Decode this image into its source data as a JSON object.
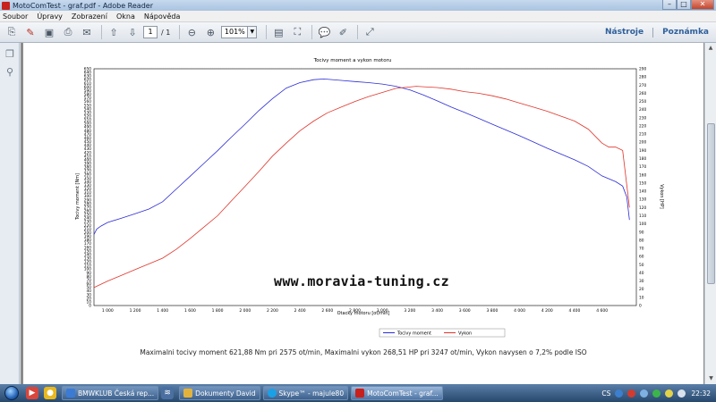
{
  "window": {
    "title": "MotoComTest - graf.pdf - Adobe Reader",
    "buttons": {
      "minimize": "–",
      "maximize": "□",
      "close": "✕"
    }
  },
  "menu": [
    "Soubor",
    "Úpravy",
    "Zobrazení",
    "Okna",
    "Nápověda"
  ],
  "toolbar": {
    "page_current": "1",
    "page_total": "/ 1",
    "zoom": "101%",
    "tools_link": "Nástroje",
    "comment_link": "Poznámka"
  },
  "document": {
    "watermark": "www.moravia-tuning.cz",
    "caption": "Maximalni tocivy moment 621,88 Nm pri 2575 ot/min,  Maximalni vykon 268,51 HP pri 3247 ot/min,  Vykon navysen o 7,2% podle ISO"
  },
  "chart_data": {
    "type": "line",
    "title": "Tocivy moment a vykon motoru",
    "xlabel": "Otacky motoru [ot/min]",
    "ylabel": "Tocivy moment [Nm]",
    "y2label": "Vykon [HP]",
    "xlim": [
      900,
      4850
    ],
    "ylim": [
      0,
      650
    ],
    "y2lim": [
      0,
      290
    ],
    "x_ticks": [
      1000,
      1200,
      1400,
      1600,
      1800,
      2000,
      2200,
      2400,
      2600,
      2800,
      3000,
      3200,
      3400,
      3600,
      3800,
      4000,
      4200,
      4400,
      4600
    ],
    "x_tick_labels": [
      "1 000",
      "1 200",
      "1 400",
      "1 600",
      "1 800",
      "2 000",
      "2 200",
      "2 400",
      "2 600",
      "2 800",
      "3 000",
      "3 200",
      "3 400",
      "3 600",
      "3 800",
      "4 000",
      "4 200",
      "4 400",
      "4 600"
    ],
    "y_ticks": [
      0,
      10,
      20,
      30,
      40,
      50,
      60,
      70,
      80,
      90,
      100,
      110,
      120,
      130,
      140,
      150,
      160,
      170,
      180,
      190,
      200,
      210,
      220,
      230,
      240,
      250,
      260,
      270,
      280,
      290,
      300,
      310,
      320,
      330,
      340,
      350,
      360,
      370,
      380,
      390,
      400,
      410,
      420,
      430,
      440,
      450,
      460,
      470,
      480,
      490,
      500,
      510,
      520,
      530,
      540,
      550,
      560,
      570,
      580,
      590,
      600,
      610,
      620,
      630,
      640,
      650
    ],
    "y2_ticks": [
      0,
      10,
      20,
      30,
      40,
      50,
      60,
      70,
      80,
      90,
      100,
      110,
      120,
      130,
      140,
      150,
      160,
      170,
      180,
      190,
      200,
      210,
      220,
      230,
      240,
      250,
      260,
      270,
      280,
      290
    ],
    "grid": true,
    "legend_position": "bottom-right",
    "series": [
      {
        "name": "Tocivy moment",
        "color": "#2b2bd6",
        "axis": "left",
        "x": [
          900,
          920,
          950,
          1000,
          1100,
          1200,
          1300,
          1400,
          1500,
          1600,
          1700,
          1800,
          1900,
          2000,
          2100,
          2200,
          2300,
          2400,
          2500,
          2575,
          2700,
          2800,
          2900,
          3000,
          3100,
          3200,
          3300,
          3400,
          3500,
          3600,
          3700,
          3800,
          3900,
          4000,
          4100,
          4200,
          4300,
          4400,
          4500,
          4600,
          4700,
          4750,
          4780,
          4800
        ],
        "y": [
          195,
          210,
          218,
          228,
          240,
          252,
          265,
          285,
          320,
          355,
          390,
          425,
          462,
          498,
          535,
          568,
          597,
          612,
          620,
          622,
          618,
          615,
          612,
          608,
          602,
          592,
          578,
          562,
          545,
          530,
          514,
          498,
          482,
          466,
          449,
          432,
          416,
          400,
          382,
          356,
          340,
          328,
          298,
          235
        ]
      },
      {
        "name": "Vykon",
        "color": "#e0342a",
        "axis": "right",
        "x": [
          900,
          1000,
          1100,
          1200,
          1300,
          1400,
          1500,
          1600,
          1700,
          1800,
          1900,
          2000,
          2100,
          2200,
          2300,
          2400,
          2500,
          2600,
          2700,
          2800,
          2900,
          3000,
          3100,
          3247,
          3300,
          3400,
          3500,
          3600,
          3700,
          3800,
          3900,
          4000,
          4100,
          4200,
          4300,
          4400,
          4500,
          4600,
          4650,
          4700,
          4750,
          4800
        ],
        "y": [
          22,
          30,
          37,
          44,
          51,
          58,
          69,
          82,
          96,
          110,
          128,
          146,
          164,
          183,
          199,
          214,
          226,
          236,
          243,
          250,
          256,
          261,
          266,
          268.5,
          268,
          267,
          265,
          262,
          260,
          257,
          253,
          248,
          243,
          238,
          232,
          226,
          216,
          199,
          194,
          194,
          190,
          120
        ]
      }
    ]
  },
  "taskbar": {
    "items": [
      {
        "label": "BMWKLUB Česká rep...",
        "color": "#3b7bd4"
      },
      {
        "label": "Dokumenty David",
        "color": "#e2b33c"
      },
      {
        "label": "Skype™ - majule80",
        "color": "#1aa0e6"
      },
      {
        "label": "MotoComTest - graf...",
        "color": "#c8201c"
      }
    ],
    "lang": "CS",
    "time": "22:32"
  },
  "colors": {
    "accent": "#2f5f9a",
    "torque": "#2b2bd6",
    "power": "#e0342a"
  }
}
